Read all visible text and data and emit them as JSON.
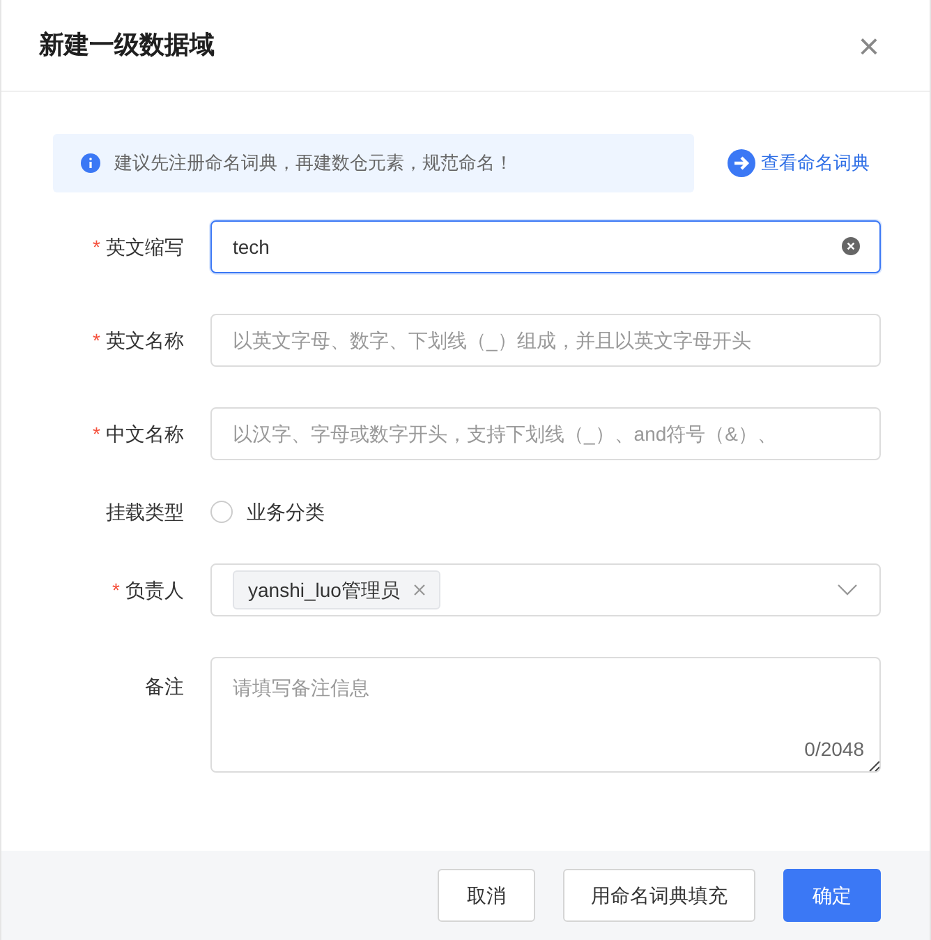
{
  "dialog": {
    "title": "新建一级数据域",
    "close": "×"
  },
  "notice": {
    "text": "建议先注册命名词典，再建数仓元素，规范命名！",
    "link": "查看命名词典"
  },
  "fields": [
    {
      "kind": "input",
      "label": "英文缩写",
      "marker": "*",
      "value": "tech",
      "focused": true
    },
    {
      "kind": "input",
      "label": "英文名称",
      "marker": "*",
      "placeholder": "以英文字母、数字、下划线（_）组成，并且以英文字母开头",
      "focused": false
    },
    {
      "kind": "input",
      "label": "中文名称",
      "marker": "*",
      "placeholder": "以汉字、字母或数字开头，支持下划线（_）、and符号（&）、",
      "focused": false
    },
    {
      "kind": "radio",
      "label": "挂载类型",
      "options": [
        {
          "label": "业务分类",
          "selected": false
        }
      ]
    },
    {
      "kind": "select",
      "label": "负责人",
      "marker": "*",
      "tags": [
        "yanshi_luo管理员"
      ]
    },
    {
      "kind": "textarea",
      "label": "备注",
      "placeholder": "请填写备注信息",
      "counter": "0/2048"
    }
  ],
  "buttons": [
    {
      "label": "取消",
      "kind": "default"
    },
    {
      "label": "用命名词典填充",
      "kind": "default"
    },
    {
      "label": "确定",
      "kind": "primary"
    }
  ]
}
